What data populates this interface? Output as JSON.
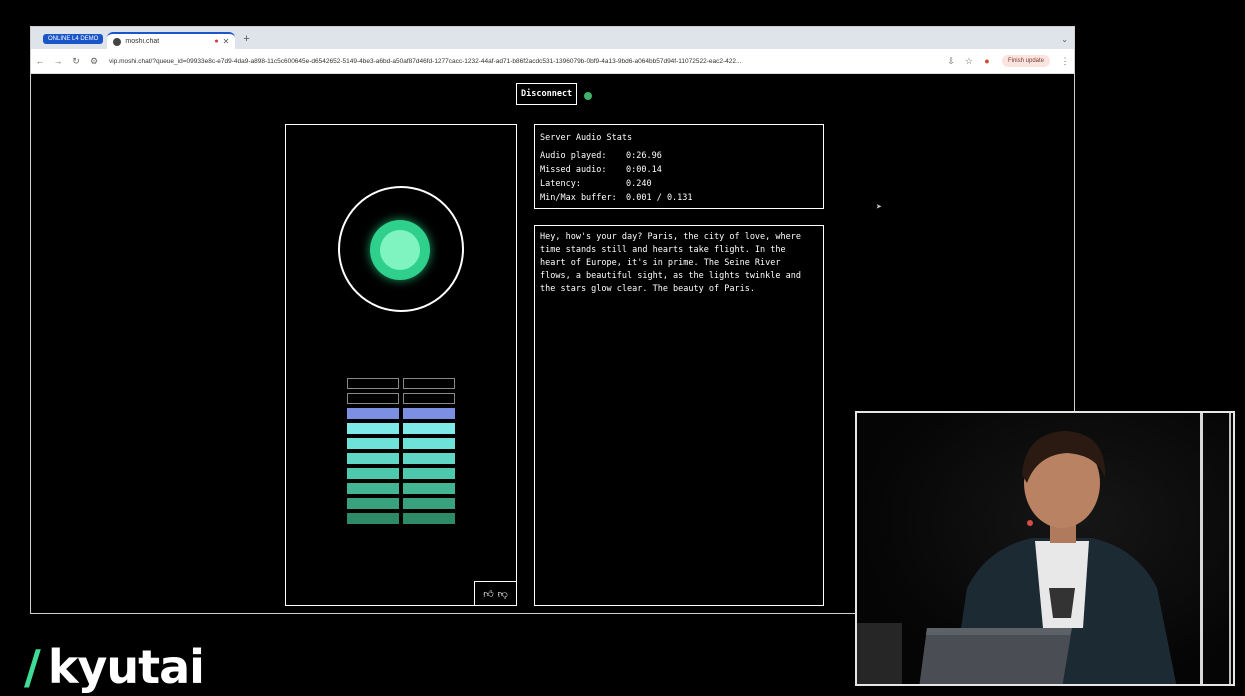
{
  "browser": {
    "tab_group": "ONLINE L4 DEMO",
    "tab_title": "moshi.chat",
    "new_tab_icon": "plus",
    "url": "vip.moshi.chat/?queue_id=09933e8c-e7d9-4da9-a898-11c5c600645e-d6542652-5149-4be3-a6bd-a50af87d46fd-1277cacc-1232-44af-ad71-b86f2acdc531-1396079b-0bf9-4a13-9bd6-a064bb57d94f-11072522-eac2-422...",
    "finish_update_label": "Finish update"
  },
  "app": {
    "disconnect_label": "Disconnect",
    "status_color": "#3db36a",
    "stats": {
      "title": "Server Audio Stats",
      "rows": [
        {
          "label": "Audio played:",
          "value": "0:26.96"
        },
        {
          "label": "Missed audio:",
          "value": "0:00.14"
        },
        {
          "label": "Latency:",
          "value": "0.240"
        },
        {
          "label": "Min/Max buffer:",
          "value": "0.001 / 0.131"
        }
      ]
    },
    "transcript": "Hey, how's your day? Paris, the city of love, where\ntime stands still and hearts take flight. In the\nheart of Europe, it's in prime. The Seine River\nflows, a beautiful sight, as the lights twinkle and\nthe stars glow clear. The beauty of Paris.",
    "meter_colors": [
      "#000000",
      "#000000",
      "#7b8fe3",
      "#7ee9e6",
      "#6ee2d8",
      "#5fd7c4",
      "#4ec8ac",
      "#43b593",
      "#3aa17e",
      "#2f8a68"
    ],
    "orb_color": "#2fd08c",
    "feedback_icons": [
      "thumbs-up",
      "thumbs-down"
    ]
  },
  "branding": {
    "logo_slash": "/",
    "logo_text": "kyutai",
    "accent": "#3ddc97"
  }
}
